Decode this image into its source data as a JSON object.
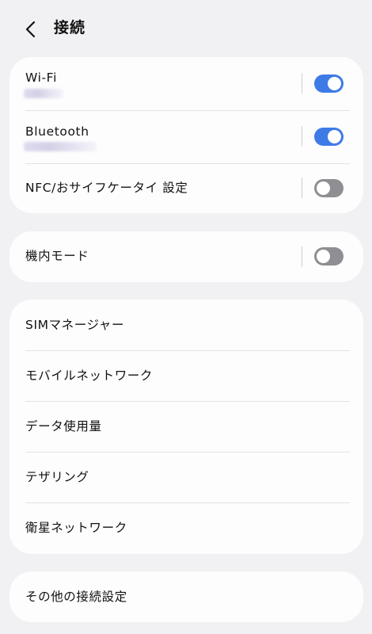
{
  "header": {
    "title": "接続",
    "back_icon": "chevron-left-icon"
  },
  "colors": {
    "background": "#f1f1f3",
    "card": "#fdfdfe",
    "toggle_on": "#3e7be6",
    "toggle_off": "#8e8e93"
  },
  "group_connectivity": {
    "items": [
      {
        "label": "Wi-Fi",
        "toggle": "on",
        "subtitle_blurred": true
      },
      {
        "label": "Bluetooth",
        "toggle": "on",
        "subtitle_blurred": true
      },
      {
        "label": "NFC/おサイフケータイ 設定",
        "toggle": "off"
      }
    ]
  },
  "group_airplane": {
    "items": [
      {
        "label": "機内モード",
        "toggle": "off"
      }
    ]
  },
  "group_network": {
    "items": [
      {
        "label": "SIMマネージャー"
      },
      {
        "label": "モバイルネットワーク"
      },
      {
        "label": "データ使用量"
      },
      {
        "label": "テザリング"
      },
      {
        "label": "衛星ネットワーク"
      }
    ]
  },
  "group_other": {
    "items": [
      {
        "label": "その他の接続設定"
      }
    ]
  }
}
